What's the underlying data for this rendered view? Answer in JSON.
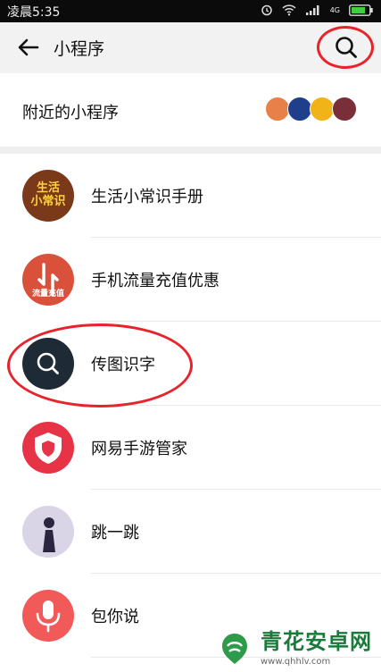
{
  "status_bar": {
    "time": "凌晨5:35",
    "net": "4G"
  },
  "header": {
    "title": "小程序"
  },
  "nearby": {
    "label": "附近的小程序",
    "logo_colors": [
      "#e8804a",
      "#1f3f8c",
      "#f2b318",
      "#7a2e3a"
    ]
  },
  "items": [
    {
      "name": "生活小常识手册",
      "icon": "life-tips-logo",
      "icon_text": "生活\n小常识",
      "color": "#7a3a1a"
    },
    {
      "name": "手机流量充值优惠",
      "icon": "data-recharge-logo",
      "icon_text": "流量充值",
      "color": "#d9503b"
    },
    {
      "name": "传图识字",
      "icon": "magnifier-logo",
      "color": "#1e2a36"
    },
    {
      "name": "网易手游管家",
      "icon": "shield-logo",
      "color": "#e63446"
    },
    {
      "name": "跳一跳",
      "icon": "jump-figure-logo",
      "color": "#d9d4e6"
    },
    {
      "name": "包你说",
      "icon": "microphone-logo",
      "color": "#f25a5a"
    }
  ],
  "watermark": {
    "name": "青花安卓网",
    "url": "www.qhhlv.com"
  }
}
